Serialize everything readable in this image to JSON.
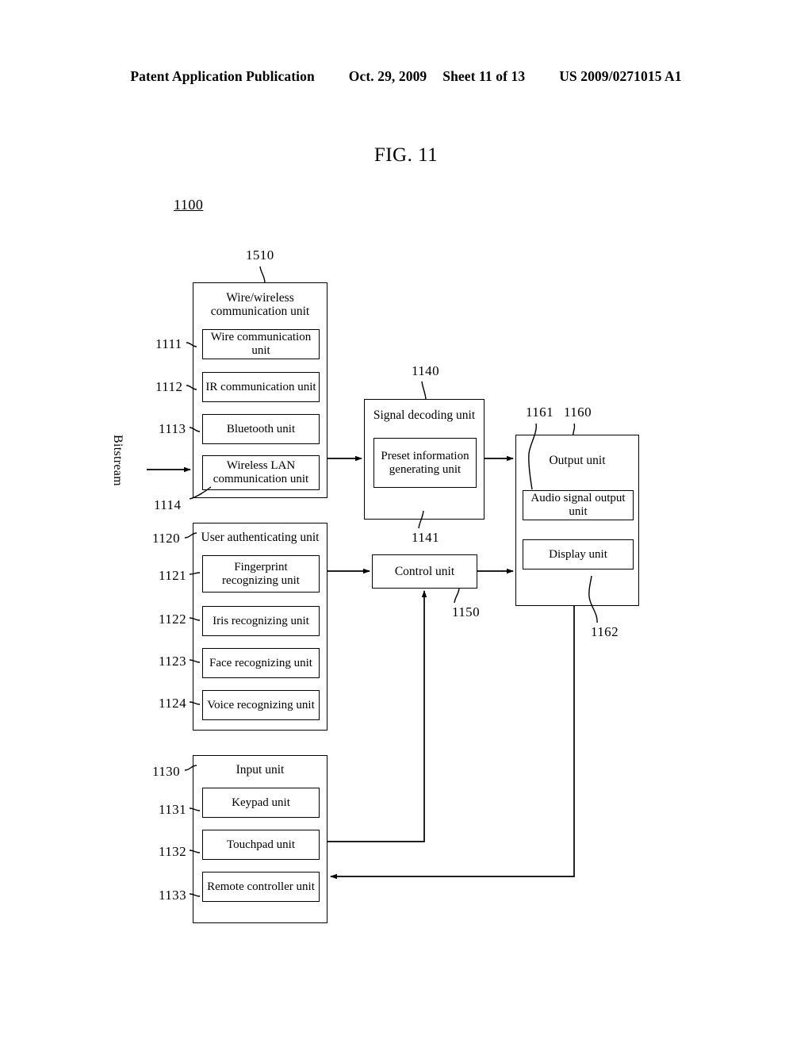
{
  "header": {
    "publication": "Patent Application Publication",
    "date": "Oct. 29, 2009",
    "sheet": "Sheet 11 of 13",
    "patent_number": "US 2009/0271015 A1"
  },
  "figure": {
    "title": "FIG. 11",
    "system_ref": "1100",
    "input_label": "Bitstream"
  },
  "blocks": {
    "wire_wireless": {
      "ref": "1510",
      "title_line1": "Wire/wireless",
      "title_line2": "communication unit",
      "children": [
        {
          "ref": "1111",
          "label": "Wire communication unit"
        },
        {
          "ref": "1112",
          "label": "IR communication unit"
        },
        {
          "ref": "1113",
          "label": "Bluetooth unit"
        },
        {
          "ref": "1114",
          "label_line1": "Wireless LAN",
          "label_line2": "communication unit"
        }
      ]
    },
    "user_authenticating": {
      "ref": "1120",
      "title": "User authenticating unit",
      "children": [
        {
          "ref": "1121",
          "label_line1": "Fingerprint",
          "label_line2": "recognizing unit"
        },
        {
          "ref": "1122",
          "label": "Iris recognizing unit"
        },
        {
          "ref": "1123",
          "label": "Face recognizing unit"
        },
        {
          "ref": "1124",
          "label": "Voice recognizing unit"
        }
      ]
    },
    "input_unit": {
      "ref": "1130",
      "title": "Input unit",
      "children": [
        {
          "ref": "1131",
          "label": "Keypad unit"
        },
        {
          "ref": "1132",
          "label": "Touchpad unit"
        },
        {
          "ref": "1133",
          "label": "Remote controller unit"
        }
      ]
    },
    "signal_decoding": {
      "ref": "1140",
      "title": "Signal decoding unit",
      "children": [
        {
          "ref": "1141",
          "label_line1": "Preset information",
          "label_line2": "generating unit"
        }
      ]
    },
    "control_unit": {
      "ref": "1150",
      "title": "Control unit"
    },
    "output_unit": {
      "ref": "1160",
      "title": "Output unit",
      "children": [
        {
          "ref": "1161",
          "label": "Audio signal output unit"
        },
        {
          "ref": "1162",
          "label": "Display unit"
        }
      ]
    }
  }
}
